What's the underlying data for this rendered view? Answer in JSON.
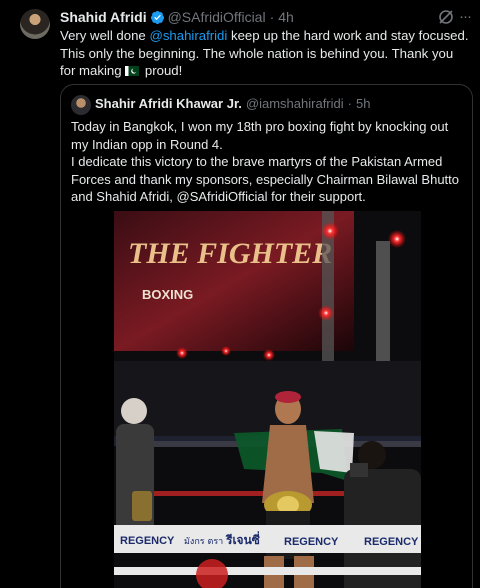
{
  "tweet": {
    "author_name": "Shahid Afridi",
    "author_handle": "@SAfridiOfficial",
    "separator": "·",
    "time": "4h",
    "text_part1": "Very well done ",
    "mention": "@shahirafridi",
    "text_part2": " keep up the hard work and stay focused. This only the beginning. The whole nation is behind you. Thank you for making ",
    "text_part3": " proud!",
    "icons": [
      "verified-badge-icon",
      "grok-icon",
      "more-icon",
      "pakistan-flag-icon"
    ],
    "colors": {
      "link": "#1d9bf0",
      "verified": "#1d9bf0",
      "muted": "#71767b",
      "background": "#000000"
    }
  },
  "quote": {
    "author_name": "Shahir Afridi Khawar Jr.",
    "author_handle": "@iamshahirafridi",
    "separator": "·",
    "time": "5h",
    "line1": "Today in Bangkok, I won my 18th pro boxing fight by knocking out my Indian opp in Round 4.",
    "line2": "I dedicate this victory to the brave martyrs of the Pakistan Armed Forces and thank my sponsors, especially Chairman Bilawal Bhutto and Shahid Afridi, @SAfridiOfficial for their support."
  },
  "photo": {
    "screen_text_1": "THE FIGHTER",
    "screen_text_2": "BOXING",
    "banner_text_1": "REGENCY",
    "banner_text_2": "มังกร ตรา",
    "banner_text_3": "รีเจนซี่",
    "banner_text_4": "REGENCY",
    "banner_text_5": "REGENCY"
  }
}
